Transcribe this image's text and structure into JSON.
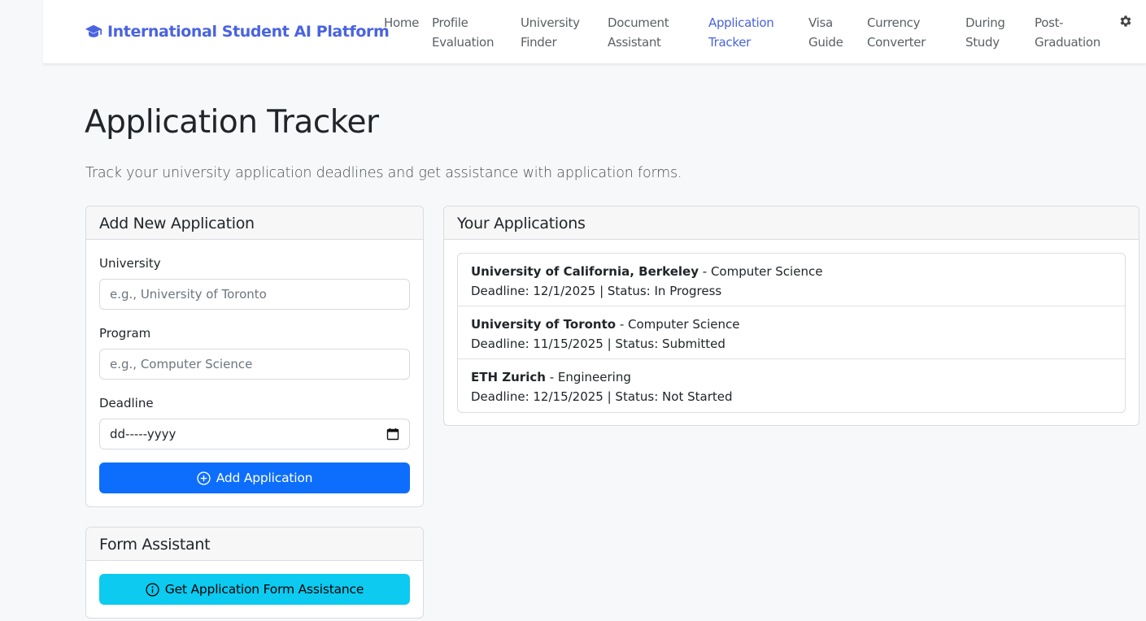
{
  "nav": {
    "brand": "International Student AI Platform",
    "items": [
      {
        "line1": "Home",
        "line2": ""
      },
      {
        "line1": "Profile",
        "line2": "Evaluation"
      },
      {
        "line1": "University",
        "line2": "Finder"
      },
      {
        "line1": "Document",
        "line2": "Assistant"
      },
      {
        "line1": "Application",
        "line2": "Tracker"
      },
      {
        "line1": "Visa",
        "line2": "Guide"
      },
      {
        "line1": "Currency",
        "line2": "Converter"
      },
      {
        "line1": "During",
        "line2": "Study"
      },
      {
        "line1": "Post-",
        "line2": "Graduation"
      }
    ],
    "active_index": 4
  },
  "page": {
    "title": "Application Tracker",
    "subtitle": "Track your university application deadlines and get assistance with application forms."
  },
  "add_form": {
    "header": "Add New Application",
    "university_label": "University",
    "university_placeholder": "e.g., University of Toronto",
    "program_label": "Program",
    "program_placeholder": "e.g., Computer Science",
    "deadline_label": "Deadline",
    "deadline_placeholder": "dd-----yyyy",
    "submit_label": "Add Application"
  },
  "form_assistant": {
    "header": "Form Assistant",
    "button_label": "Get Application Form Assistance"
  },
  "applications": {
    "header": "Your Applications",
    "items": [
      {
        "university": "University of California, Berkeley",
        "program": " - Computer Science",
        "detail": "Deadline: 12/1/2025 | Status: In Progress"
      },
      {
        "university": "University of Toronto",
        "program": " - Computer Science",
        "detail": "Deadline: 11/15/2025 | Status: Submitted"
      },
      {
        "university": "ETH Zurich",
        "program": " - Engineering",
        "detail": "Deadline: 12/15/2025 | Status: Not Started"
      }
    ]
  },
  "colors": {
    "brand": "#4a63e0",
    "primary": "#0d6efd",
    "info": "#0dcaf0"
  }
}
